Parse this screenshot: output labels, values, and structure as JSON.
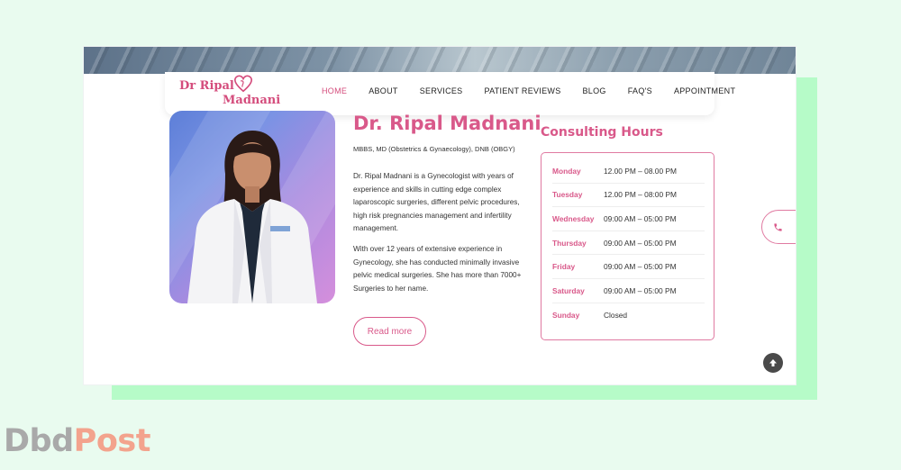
{
  "site": {
    "logo_line1": "Dr Ripal",
    "logo_line2": "Madnani",
    "nav": [
      "HOME",
      "ABOUT",
      "SERVICES",
      "PATIENT REVIEWS",
      "BLOG",
      "FAQ'S",
      "APPOINTMENT"
    ],
    "active_nav": "HOME"
  },
  "profile": {
    "name": "Dr. Ripal Madnani",
    "qualifications": "MBBS, MD (Obstetrics & Gynaecology), DNB (OBGY)",
    "paragraph1": "Dr. Ripal Madnani is a Gynecologist with years of experience and skills in cutting edge complex laparoscopic surgeries, different pelvic procedures, high risk pregnancies management and infertility management.",
    "paragraph2": "With over 12 years of extensive experience in Gynecology, she has conducted minimally invasive pelvic medical surgeries. She has more than 7000+ Surgeries to her name.",
    "read_more_label": "Read more"
  },
  "hours": {
    "title": "Consulting Hours",
    "rows": [
      {
        "day": "Monday",
        "time": "12.00 PM – 08.00 PM"
      },
      {
        "day": "Tuesday",
        "time": "12.00 PM – 08:00 PM"
      },
      {
        "day": "Wednesday",
        "time": "09:00 AM – 05:00 PM"
      },
      {
        "day": "Thursday",
        "time": "09:00 AM – 05:00 PM"
      },
      {
        "day": "Friday",
        "time": "09:00 AM – 05:00 PM"
      },
      {
        "day": "Saturday",
        "time": "09:00 AM – 05:00 PM"
      },
      {
        "day": "Sunday",
        "time": "Closed"
      }
    ]
  },
  "icons": {
    "phone": "phone-icon",
    "scroll_top": "arrow-up-icon"
  },
  "watermark": {
    "part1": "Dbd",
    "part2": "Post"
  },
  "colors": {
    "accent": "#d9598a",
    "mint_bg": "#e9fbef",
    "mint_shadow": "#b6fbc8"
  }
}
